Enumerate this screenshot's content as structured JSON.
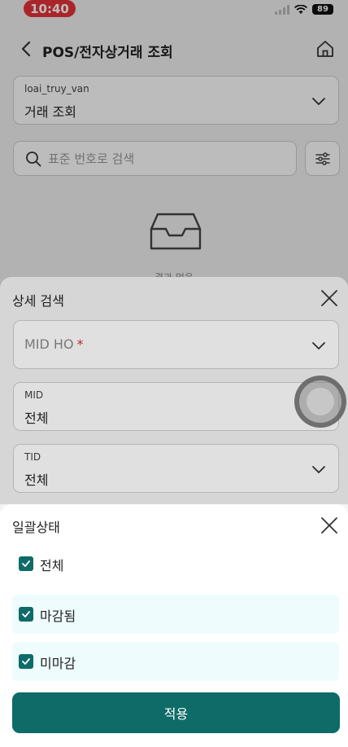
{
  "status_bar": {
    "time": "10:40",
    "battery": "89"
  },
  "header": {
    "title": "POS/전자상거래 조회"
  },
  "query_type": {
    "label": "loai_truy_van",
    "value": "거래 조회"
  },
  "search": {
    "placeholder": "표준 번호로 검색"
  },
  "empty_state": {
    "text": "결과 없음"
  },
  "detail_sheet": {
    "title": "상세 검색",
    "mid_ho": {
      "placeholder": "MID HO",
      "required_mark": "*"
    },
    "mid": {
      "label": "MID",
      "value": "전체"
    },
    "tid": {
      "label": "TID",
      "value": "전체"
    }
  },
  "status_sheet": {
    "title": "일괄상태",
    "options": [
      {
        "label": "전체",
        "checked": true
      },
      {
        "label": "마감됨",
        "checked": true
      },
      {
        "label": "미마감",
        "checked": true
      }
    ],
    "apply_label": "적용"
  },
  "colors": {
    "accent": "#0e6b68",
    "time_pill": "#e8343a",
    "row_highlight": "#eefcfd"
  }
}
